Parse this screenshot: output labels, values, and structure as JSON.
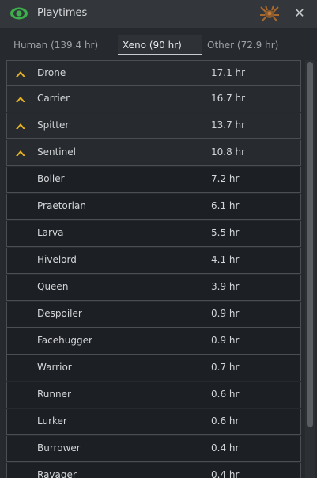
{
  "window": {
    "title": "Playtimes",
    "close_label": "✕"
  },
  "tabs": [
    {
      "label": "Human (139.4 hr)",
      "active": false
    },
    {
      "label": "Xeno (90 hr)",
      "active": true
    },
    {
      "label": "Other (72.9 hr)",
      "active": false
    }
  ],
  "rows": [
    {
      "name": "Drone",
      "time": "17.1 hr",
      "rank_icon": "rank-chevron-icon"
    },
    {
      "name": "Carrier",
      "time": "16.7 hr",
      "rank_icon": "rank-chevron-icon"
    },
    {
      "name": "Spitter",
      "time": "13.7 hr",
      "rank_icon": "rank-chevron-icon"
    },
    {
      "name": "Sentinel",
      "time": "10.8 hr",
      "rank_icon": "rank-chevron-icon"
    },
    {
      "name": "Boiler",
      "time": "7.2 hr"
    },
    {
      "name": "Praetorian",
      "time": "6.1 hr"
    },
    {
      "name": "Larva",
      "time": "5.5 hr"
    },
    {
      "name": "Hivelord",
      "time": "4.1 hr"
    },
    {
      "name": "Queen",
      "time": "3.9 hr"
    },
    {
      "name": "Despoiler",
      "time": "0.9 hr"
    },
    {
      "name": "Facehugger",
      "time": "0.9 hr"
    },
    {
      "name": "Warrior",
      "time": "0.7 hr"
    },
    {
      "name": "Runner",
      "time": "0.6 hr"
    },
    {
      "name": "Lurker",
      "time": "0.6 hr"
    },
    {
      "name": "Burrower",
      "time": "0.4 hr"
    },
    {
      "name": "Ravager",
      "time": "0.4 hr"
    }
  ],
  "colors": {
    "rank_icon": "#e8b320",
    "eye_icon": "#3cb04a"
  },
  "scroll": {
    "position": 0
  }
}
